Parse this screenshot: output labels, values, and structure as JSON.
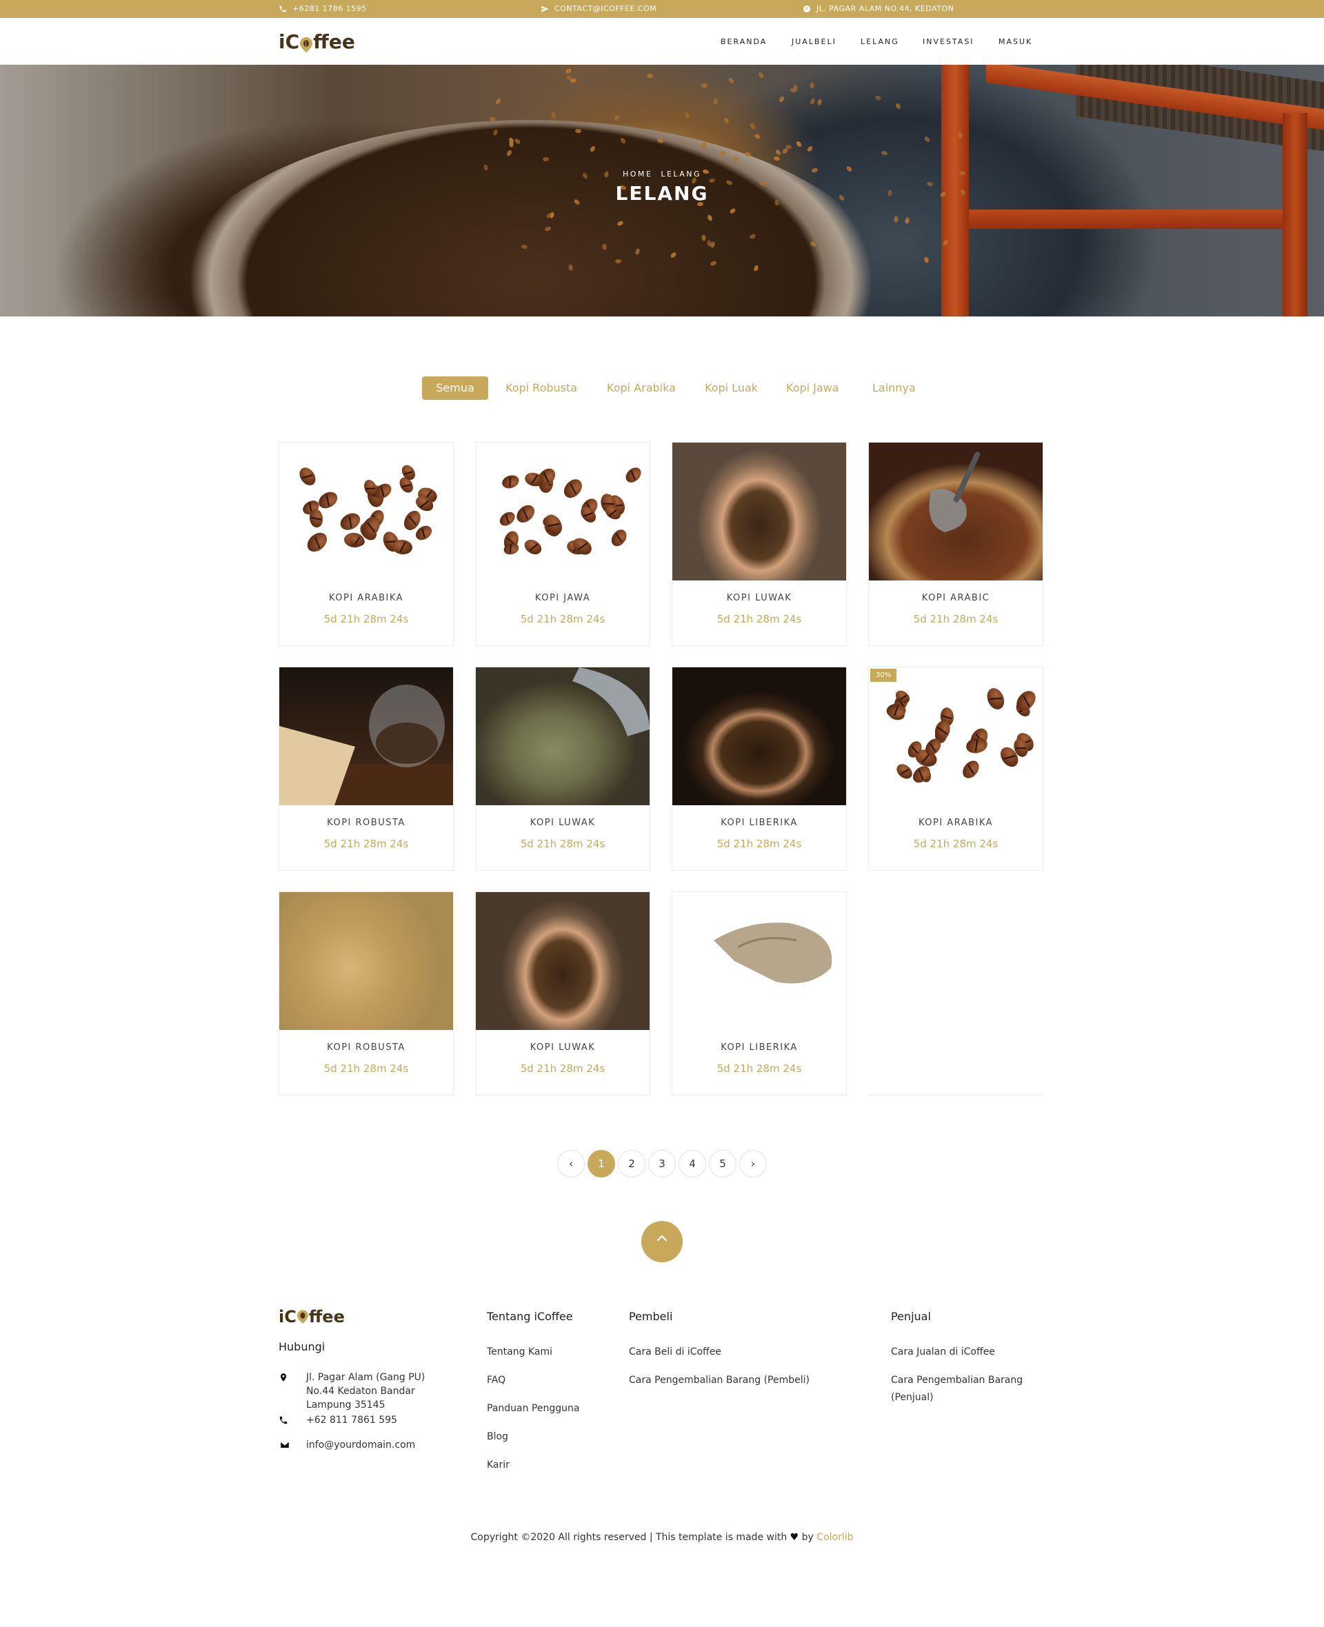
{
  "topbar": {
    "phone": "+6281 1786 1595",
    "email": "CONTACT@ICOFFEE.COM",
    "address": "JL. PAGAR ALAM NO.44, KEDATON"
  },
  "brand": {
    "logo_left": "iC",
    "logo_right": "ffee"
  },
  "nav": [
    "BERANDA",
    "JUALBELI",
    "LELANG",
    "INVESTASI",
    "MASUK"
  ],
  "hero": {
    "breadcrumb_home": "HOME",
    "breadcrumb_current": "LELANG",
    "title": "LELANG"
  },
  "tabs": [
    "Semua",
    "Kopi Robusta",
    "Kopi Arabika",
    "Kopi Luak",
    "Kopi Jawa",
    "Lainnya"
  ],
  "products": [
    {
      "name": "KOPI ARABIKA",
      "timer": "5d 21h 28m 24s"
    },
    {
      "name": "KOPI JAWA",
      "timer": "5d 21h 28m 24s"
    },
    {
      "name": "KOPI LUWAK",
      "timer": "5d 21h 28m 24s"
    },
    {
      "name": "KOPI ARABIC",
      "timer": "5d 21h 28m 24s"
    },
    {
      "name": "KOPI ROBUSTA",
      "timer": "5d 21h 28m 24s"
    },
    {
      "name": "KOPI LUWAK",
      "timer": "5d 21h 28m 24s"
    },
    {
      "name": "KOPI LIBERIKA",
      "timer": "5d 21h 28m 24s"
    },
    {
      "name": "KOPI ARABIKA",
      "timer": "5d 21h 28m 24s",
      "badge": "30%"
    },
    {
      "name": "KOPI ROBUSTA",
      "timer": "5d 21h 28m 24s"
    },
    {
      "name": "KOPI LUWAK",
      "timer": "5d 21h 28m 24s"
    },
    {
      "name": "KOPI LIBERIKA",
      "timer": "5d 21h 28m 24s"
    }
  ],
  "pagination": {
    "prev": "‹",
    "pages": [
      "1",
      "2",
      "3",
      "4",
      "5"
    ],
    "next": "›",
    "current": "1"
  },
  "footer": {
    "contact_heading": "Hubungi",
    "address": [
      "Jl. Pagar Alam (Gang PU)",
      "No.44 Kedaton Bandar",
      "Lampung 35145"
    ],
    "phone": "+62 811 7861 595",
    "email": "info@yourdomain.com",
    "col1": {
      "heading": "Tentang iCoffee",
      "links": [
        "Tentang Kami",
        "FAQ",
        "Panduan Pengguna",
        "Blog",
        "Karir"
      ]
    },
    "col2": {
      "heading": "Pembeli",
      "links": [
        "Cara Beli di iCoffee",
        "Cara Pengembalian Barang (Pembeli)"
      ]
    },
    "col3": {
      "heading": "Penjual",
      "links": [
        "Cara Jualan di iCoffee",
        "Cara Pengembalian Barang",
        "(Penjual)"
      ]
    },
    "copyright_text": "Copyright ©2020 All rights reserved | This template is made with",
    "copyright_by": "by",
    "copyright_brand": "Colorlib"
  },
  "colors": {
    "accent": "#c8a95c",
    "logo": "#4a3418"
  }
}
